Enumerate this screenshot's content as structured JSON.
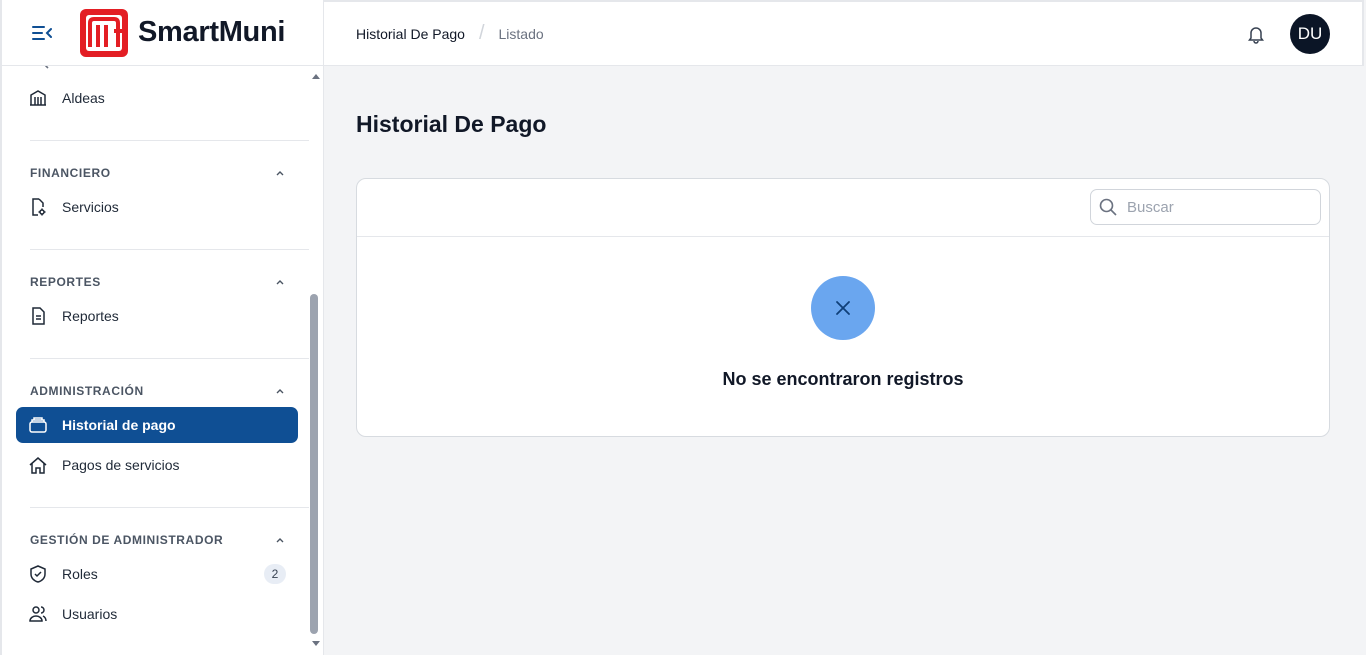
{
  "app": {
    "brand": "SmartMuni",
    "brand_color": "#e31e24",
    "accent": "#0f4f94"
  },
  "sidebar": {
    "items_top": [
      {
        "label": "Aldeas",
        "icon": "building-columns-icon"
      }
    ],
    "groups": [
      {
        "title": "FINANCIERO",
        "items": [
          {
            "label": "Servicios",
            "icon": "document-gear-icon"
          }
        ]
      },
      {
        "title": "REPORTES",
        "items": [
          {
            "label": "Reportes",
            "icon": "document-text-icon"
          }
        ]
      },
      {
        "title": "ADMINISTRACIÓN",
        "items": [
          {
            "label": "Historial de pago",
            "icon": "card-icon",
            "active": true
          },
          {
            "label": "Pagos de servicios",
            "icon": "home-icon"
          }
        ]
      },
      {
        "title": "GESTIÓN DE ADMINISTRADOR",
        "items": [
          {
            "label": "Roles",
            "icon": "shield-check-icon",
            "badge": "2"
          },
          {
            "label": "Usuarios",
            "icon": "users-icon"
          }
        ]
      }
    ]
  },
  "topbar": {
    "breadcrumb": [
      "Historial De Pago",
      "Listado"
    ],
    "avatar_initials": "DU"
  },
  "main": {
    "title": "Historial De Pago",
    "search": {
      "placeholder": "Buscar",
      "value": ""
    },
    "empty_state": {
      "icon": "x-icon",
      "message": "No se encontraron registros"
    }
  }
}
